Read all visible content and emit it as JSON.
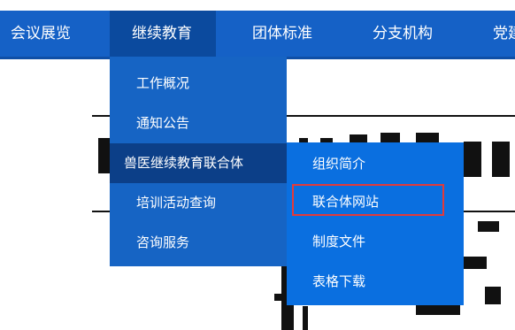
{
  "nav": {
    "items": [
      "会议展览",
      "继续教育",
      "团体标准",
      "分支机构",
      "党建"
    ],
    "active_index": 1
  },
  "dropdown": {
    "items": [
      "工作概况",
      "通知公告",
      "兽医继续教育联合体",
      "培训活动查询",
      "咨询服务"
    ],
    "active_index": 2
  },
  "submenu": {
    "items": [
      "组织简介",
      "联合体网站",
      "制度文件",
      "表格下载"
    ],
    "highlighted_index": 1
  },
  "colors": {
    "nav_bg": "#1561c6",
    "nav_active": "#0b4a9e",
    "dropdown_bg": "#1664c4",
    "dropdown_active": "#0c3f88",
    "submenu_bg": "#0a6fe0",
    "highlight_border": "#e33a3a"
  }
}
